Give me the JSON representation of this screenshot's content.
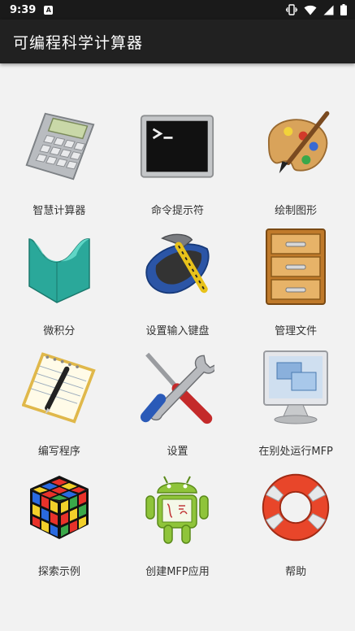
{
  "status_bar": {
    "time": "9:39",
    "notification_letter": "A",
    "icons": [
      "vibrate-icon",
      "wifi-icon",
      "signal-icon",
      "battery-icon"
    ]
  },
  "app_bar": {
    "title": "可编程科学计算器"
  },
  "menu": [
    {
      "label": "智慧计算器",
      "icon": "calculator-icon"
    },
    {
      "label": "命令提示符",
      "icon": "terminal-icon"
    },
    {
      "label": "绘制图形",
      "icon": "palette-icon"
    },
    {
      "label": "微积分",
      "icon": "calculus-surface-icon"
    },
    {
      "label": "设置输入键盘",
      "icon": "keyboard-hammer-icon"
    },
    {
      "label": "管理文件",
      "icon": "file-cabinet-icon"
    },
    {
      "label": "编写程序",
      "icon": "notepad-pen-icon"
    },
    {
      "label": "设置",
      "icon": "tools-icon"
    },
    {
      "label": "在别处运行MFP",
      "icon": "monitor-icon"
    },
    {
      "label": "探索示例",
      "icon": "rubiks-cube-icon"
    },
    {
      "label": "创建MFP应用",
      "icon": "android-icon"
    },
    {
      "label": "帮助",
      "icon": "lifebuoy-icon"
    }
  ]
}
